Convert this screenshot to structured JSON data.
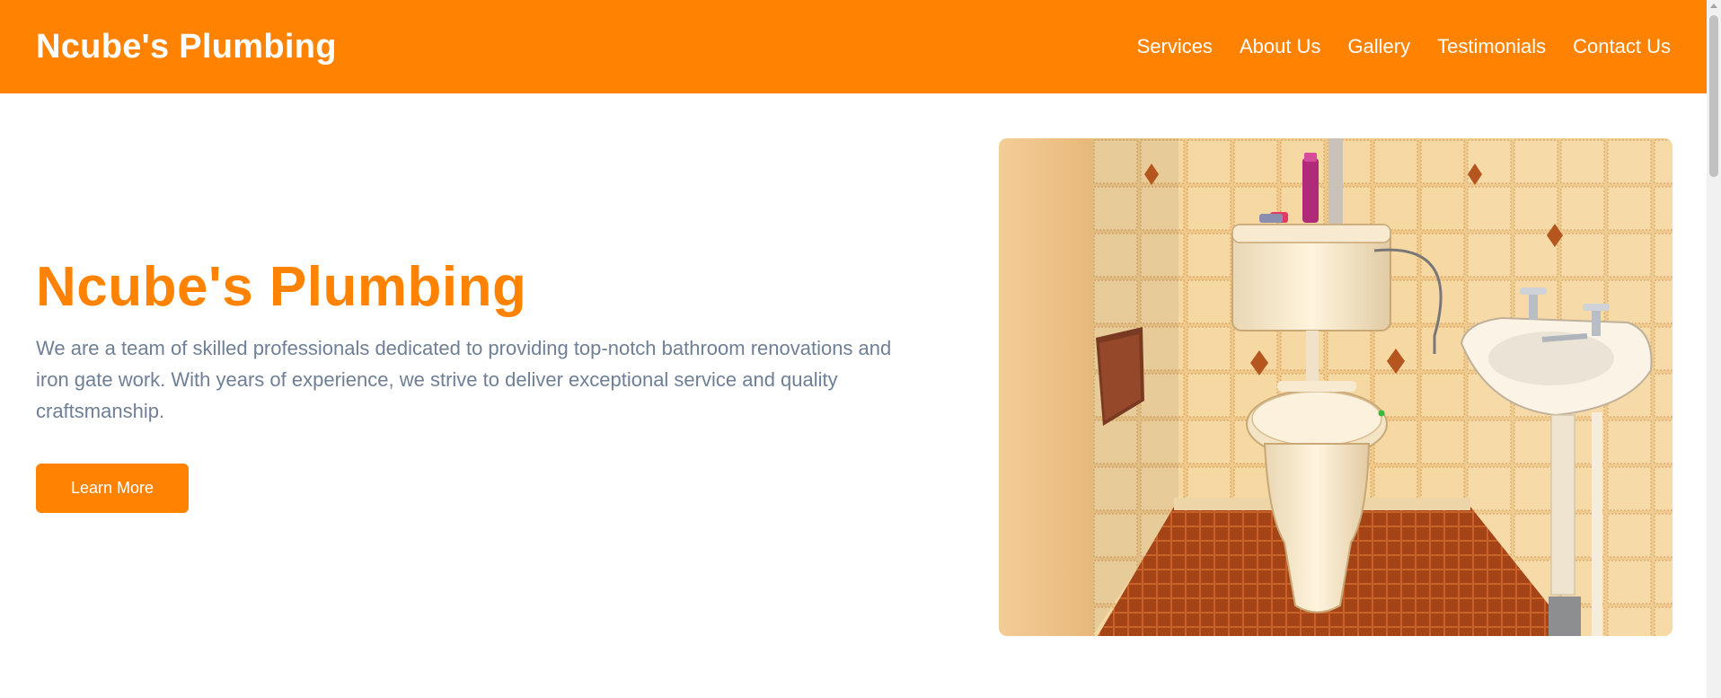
{
  "header": {
    "brand": "Ncube's Plumbing",
    "nav": [
      "Services",
      "About Us",
      "Gallery",
      "Testimonials",
      "Contact Us"
    ]
  },
  "hero": {
    "title": "Ncube's Plumbing",
    "description": "We are a team of skilled professionals dedicated to providing top-notch bathroom renovations and iron gate work. With years of experience, we strive to deliver exceptional service and quality craftsmanship.",
    "cta_label": "Learn More"
  },
  "colors": {
    "accent": "#ff8200",
    "body_text": "#6e7f96",
    "background": "#ffffff"
  },
  "icons": {
    "scroll_up": "chevron-up-icon"
  }
}
